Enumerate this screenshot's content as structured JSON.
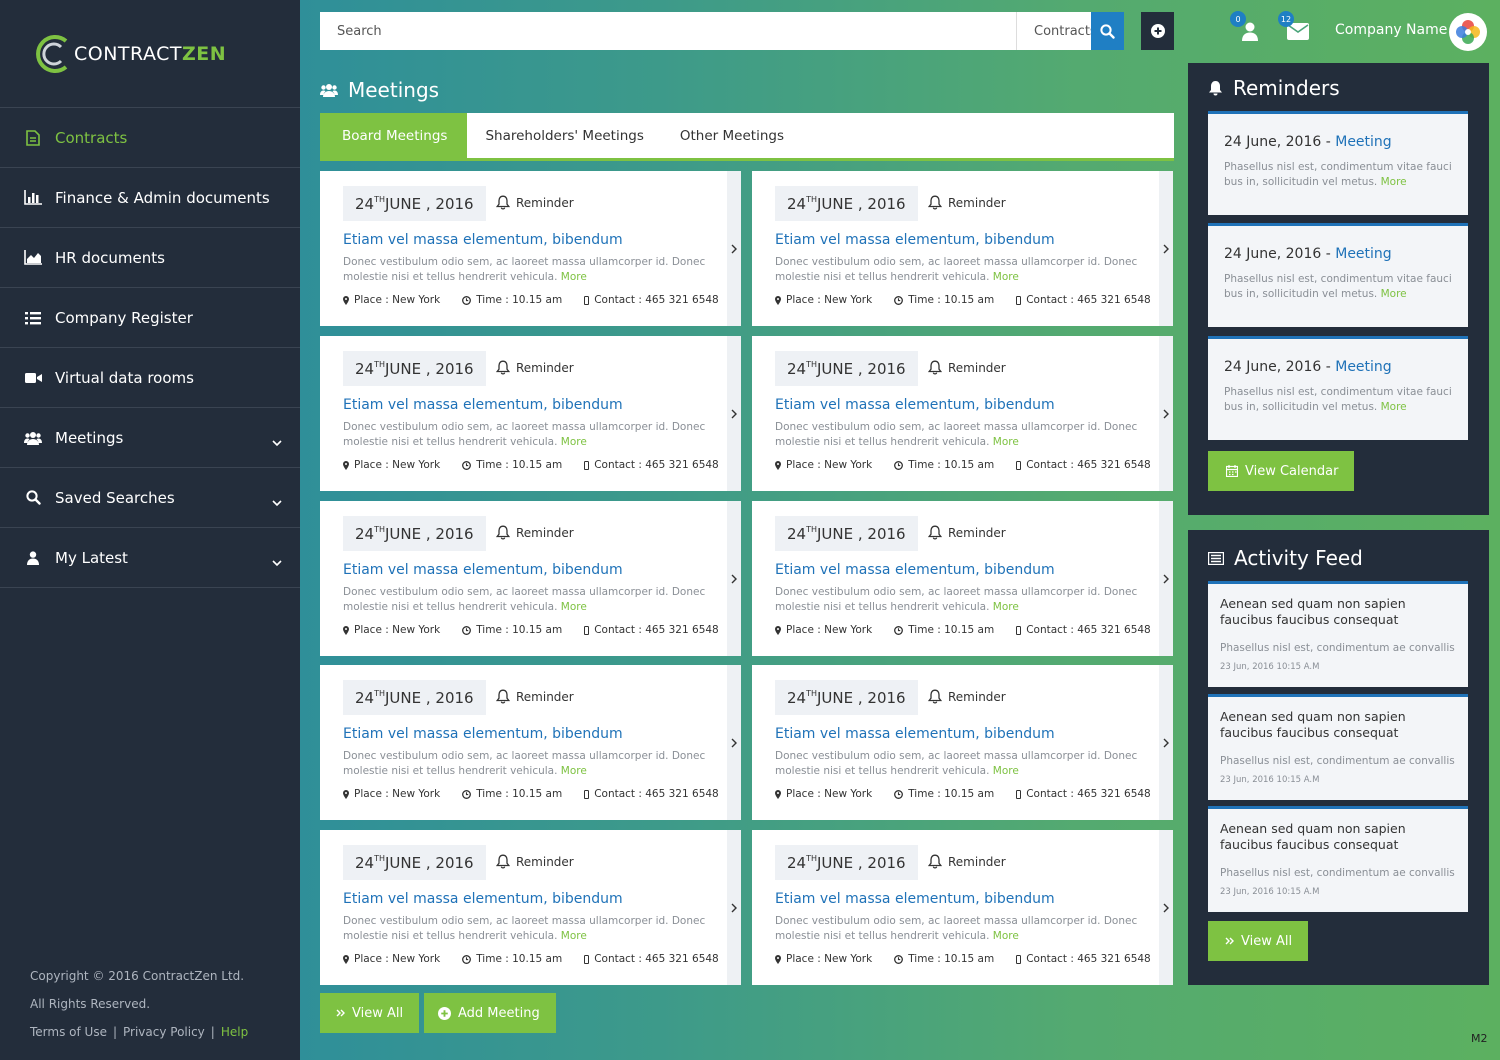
{
  "brand": {
    "name_part1": "CONTRACT",
    "name_part2": "ZEN"
  },
  "sidebar": {
    "items": [
      {
        "label": "Contracts",
        "icon": "document-icon",
        "active": true,
        "expandable": false
      },
      {
        "label": "Finance & Admin documents",
        "icon": "bar-chart-icon",
        "active": false,
        "expandable": false
      },
      {
        "label": "HR documents",
        "icon": "area-chart-icon",
        "active": false,
        "expandable": false
      },
      {
        "label": "Company Register",
        "icon": "list-icon",
        "active": false,
        "expandable": false
      },
      {
        "label": "Virtual data rooms",
        "icon": "video-camera-icon",
        "active": false,
        "expandable": false
      },
      {
        "label": "Meetings",
        "icon": "users-icon",
        "active": false,
        "expandable": true
      },
      {
        "label": "Saved Searches",
        "icon": "search-icon",
        "active": false,
        "expandable": true
      },
      {
        "label": "My Latest",
        "icon": "user-icon",
        "active": false,
        "expandable": true
      }
    ],
    "footer": {
      "copyright": "Copyright  ©  2016  ContractZen Ltd.",
      "rights": "All Rights Reserved.",
      "terms": "Terms of Use",
      "sep": "|",
      "privacy": "Privacy Policy",
      "help": "Help"
    }
  },
  "topbar": {
    "search_placeholder": "Search",
    "search_scope": "Contracts",
    "user_badge": "0",
    "mail_badge": "12",
    "company_name": "Company Name"
  },
  "meetings": {
    "title": "Meetings",
    "tabs": [
      "Board Meetings",
      "Shareholders' Meetings",
      "Other Meetings"
    ],
    "card": {
      "date_day": "24",
      "date_suffix": "TH",
      "date_rest": " JUNE , 2016",
      "reminder": "Reminder",
      "title": "Etiam vel massa elementum, bibendum",
      "desc": "Donec vestibulum odio sem, ac laoreet massa ullamcorper id. Donec molestie nisi et tellus hendrerit vehicula. ",
      "more": "More",
      "place": "Place : New York",
      "time": "Time : 10.15 am",
      "contact": "Contact : 465 321 6548"
    },
    "view_all": "View All",
    "add_meeting": "Add Meeting"
  },
  "reminders": {
    "title": "Reminders",
    "item": {
      "date": "24 June, 2016 - ",
      "link": "Meeting",
      "desc": "Phasellus nisl est, condimentum vitae fauci bus in, sollicitudin vel metus. ",
      "more": "More"
    },
    "button": "View Calendar"
  },
  "activity": {
    "title": "Activity Feed",
    "item": {
      "title": "Aenean sed quam non sapien faucibus faucibus consequat",
      "desc": "Phasellus nisl est, condimentum ae convallis",
      "time": "23 Jun, 2016  10:15 A.M"
    },
    "button": "View All"
  },
  "version": "M2",
  "colors": {
    "accent_green": "#7ec242",
    "link_blue": "#1f72b8",
    "sidebar": "#232d3b"
  }
}
